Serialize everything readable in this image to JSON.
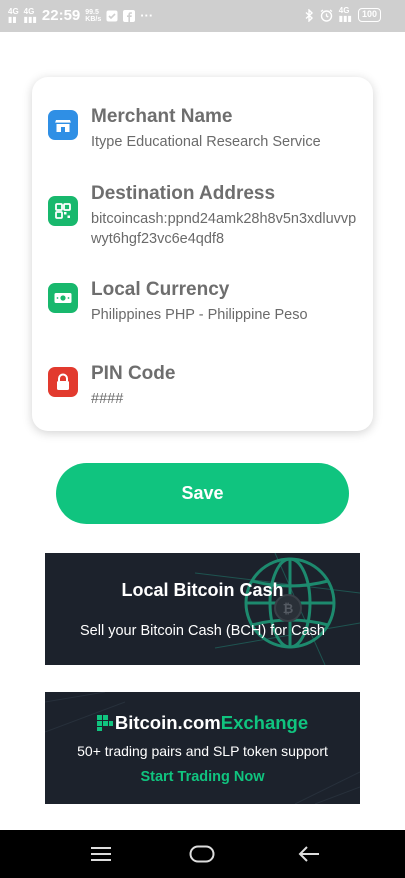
{
  "status_bar": {
    "network_1": "4G",
    "network_2": "4G",
    "time": "22:59",
    "speed_value": "99.5",
    "speed_unit": "KB/s",
    "network_right": "4G",
    "battery": "100"
  },
  "form": {
    "fields": [
      {
        "title": "Merchant Name",
        "value": "Itype Educational Research Service",
        "icon": "store-icon",
        "icon_color": "#2f8fe5"
      },
      {
        "title": "Destination Address",
        "value": "bitcoincash:ppnd24amk28h8v5n3xdluvvpwyt6hgf23vc6e4qdf8",
        "icon": "qr-code-icon",
        "icon_color": "#18b86d"
      },
      {
        "title": "Local Currency",
        "value": "Philippines PHP - Philippine Peso",
        "icon": "money-icon",
        "icon_color": "#18b86d"
      },
      {
        "title": "PIN Code",
        "value": "####",
        "icon": "lock-icon",
        "icon_color": "#e23a2e"
      }
    ],
    "save_label": "Save"
  },
  "banners": {
    "local_bitcoin": {
      "title": "Local Bitcoin Cash",
      "subtitle": "Sell your Bitcoin Cash (BCH) for Cash"
    },
    "exchange": {
      "brand": "Bitcoin.com",
      "brand_accent": "Exchange",
      "subtitle": "50+ trading pairs and SLP token support",
      "cta": "Start Trading Now"
    }
  },
  "colors": {
    "accent": "#10c47f",
    "banner_bg": "#1c222c"
  }
}
